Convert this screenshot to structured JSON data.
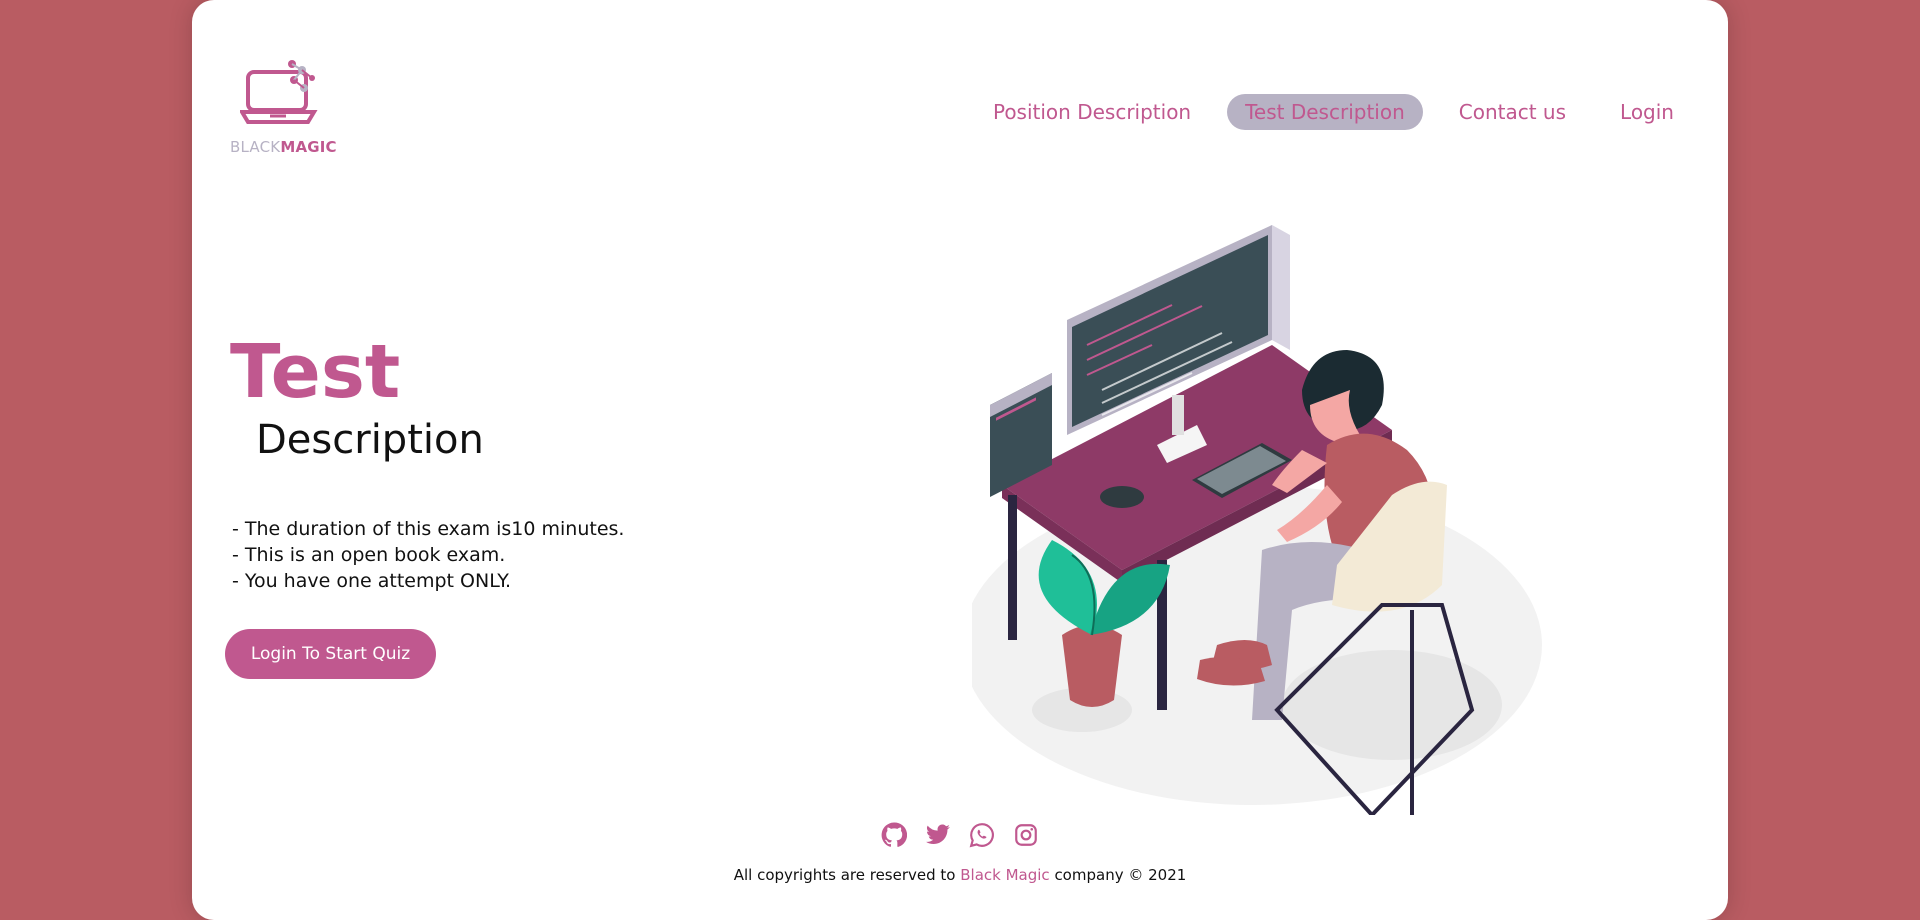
{
  "brand": {
    "logo_light": "BLACK",
    "logo_bold": "MAGIC"
  },
  "nav": {
    "items": [
      {
        "label": "Position Description",
        "active": false
      },
      {
        "label": "Test Description",
        "active": true
      },
      {
        "label": "Contact us",
        "active": false
      },
      {
        "label": "Login",
        "active": false
      }
    ]
  },
  "hero": {
    "title": "Test",
    "subtitle": "Description",
    "rules": [
      "- The duration of this exam is10 minutes.",
      "- This is an open book exam.",
      "- You have one attempt ONLY."
    ],
    "button_label": "Login To Start Quiz"
  },
  "footer": {
    "socials": [
      "github-icon",
      "twitter-icon",
      "whatsapp-icon",
      "instagram-icon"
    ],
    "copyright_prefix": "All copyrights are reserved to ",
    "copyright_brand": "Black Magic",
    "copyright_suffix": " company © 2021"
  },
  "colors": {
    "background": "#b95c62",
    "accent": "#c0588f",
    "muted": "#b7b2c4"
  }
}
